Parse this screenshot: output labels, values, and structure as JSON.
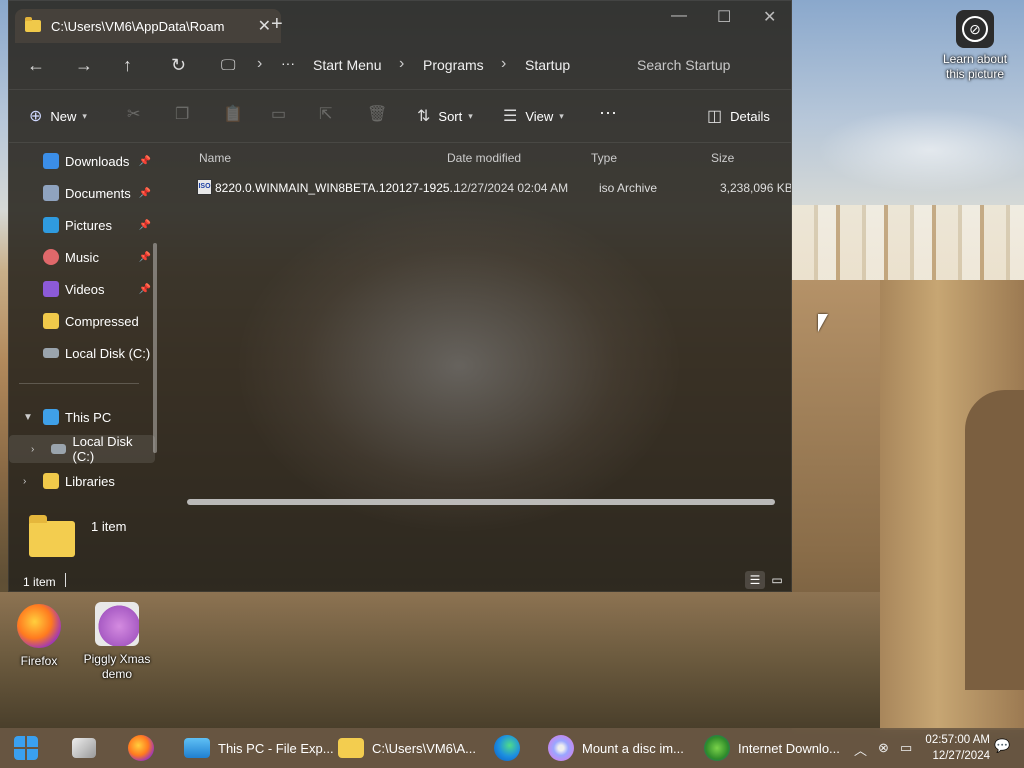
{
  "desktop": {
    "learn_label": "Learn about this picture",
    "icons": [
      {
        "label": "Firefox"
      },
      {
        "label": "Piggly Xmas demo"
      }
    ]
  },
  "window": {
    "tab_title": "C:\\Users\\VM6\\AppData\\Roam",
    "new_tab": "+",
    "controls": {
      "minimize": "—",
      "maximize": "☐",
      "close": "✕"
    },
    "nav": {
      "back": "←",
      "forward": "→",
      "up": "↑",
      "refresh": "↻",
      "more": "···"
    },
    "breadcrumbs": [
      "Start Menu",
      "Programs",
      "Startup"
    ],
    "search_placeholder": "Search Startup",
    "toolbar": {
      "new_label": "New",
      "sort_label": "Sort",
      "view_label": "View",
      "more_label": "···",
      "details_label": "Details"
    },
    "sidebar": {
      "items": [
        {
          "label": "Downloads",
          "color": "#3b8ee8"
        },
        {
          "label": "Documents",
          "color": "#8fa3bf"
        },
        {
          "label": "Pictures",
          "color": "#2f9be0"
        },
        {
          "label": "Music",
          "color": "#e0686a"
        },
        {
          "label": "Videos",
          "color": "#8c5ad8"
        },
        {
          "label": "Compressed",
          "color": "#f0c94a"
        },
        {
          "label": "Local Disk (C:)",
          "color": "#9aa4ad"
        }
      ],
      "tree": [
        {
          "label": "This PC"
        },
        {
          "label": "Local Disk (C:)"
        },
        {
          "label": "Libraries"
        }
      ]
    },
    "columns": [
      "Name",
      "Date modified",
      "Type",
      "Size"
    ],
    "files": [
      {
        "name": "8220.0.WINMAIN_WIN8BETA.120127-1925...",
        "date": "12/27/2024 02:04 AM",
        "type": "iso Archive",
        "size": "3,238,096 KB",
        "icon_text": "ISO"
      }
    ],
    "details_pane": {
      "count": "1 item"
    },
    "status": {
      "count": "1 item"
    }
  },
  "taskbar": {
    "apps": [
      {
        "label": "This PC - File Exp..."
      },
      {
        "label": "C:\\Users\\VM6\\A..."
      },
      {
        "label": "Mount a disc im..."
      },
      {
        "label": "Internet Downlo..."
      }
    ],
    "time": "02:57:00 AM",
    "date": "12/27/2024"
  }
}
